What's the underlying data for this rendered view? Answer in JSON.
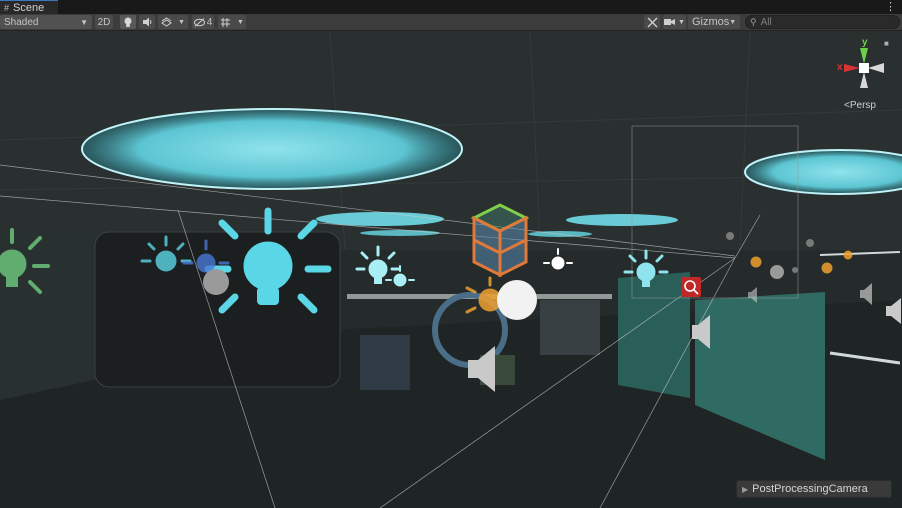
{
  "window": {
    "tab_label": "Scene"
  },
  "toolbar": {
    "shading_mode": "Shaded",
    "mode_2d": "2D",
    "hidden_count": "4",
    "gizmos_label": "Gizmos",
    "search_placeholder": "All"
  },
  "viewport": {
    "projection_label": "Persp",
    "axis_labels": {
      "y": "y",
      "x": "x"
    },
    "selected_object": "PostProcessingCamera"
  },
  "colors": {
    "light_icon": "#5ad6e6",
    "spot_light_icon": "#f0a030",
    "ceiling_light": "#9be8f0",
    "selection_box": "#aaaaaa",
    "camera_gizmo": "#d23030"
  },
  "icons": [
    "menu-icon",
    "light-toggle-icon",
    "audio-toggle-icon",
    "effects-icon",
    "hidden-objects-icon",
    "grid-icon",
    "tools-icon",
    "camera-icon",
    "search-icon",
    "lock-icon"
  ]
}
